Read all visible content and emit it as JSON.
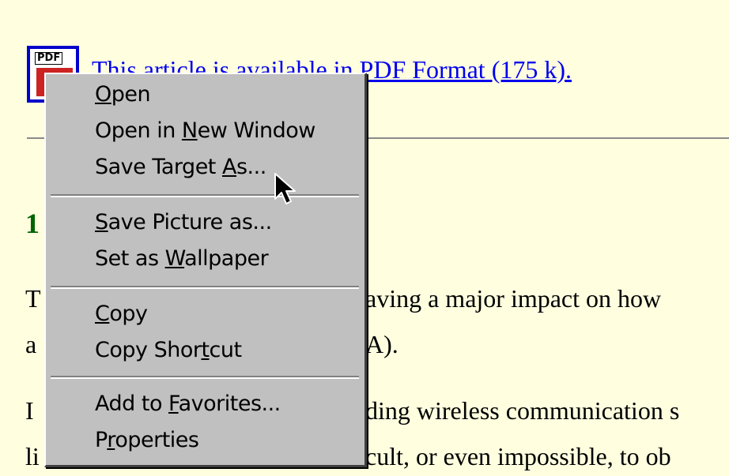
{
  "document": {
    "pdf_link_text": "This article is available in PDF Format (175 k).",
    "heading_fragment": "1",
    "para1_start": "T",
    "para1_visible_tail": "aving a major impact on how",
    "para2_start": "a",
    "para2_visible_tail": "A).",
    "para3_start": "I",
    "para3_visible_tail": "ding wireless communication s",
    "para4_start": "li",
    "para4_visible_tail": "cult, or even impossible, to ob"
  },
  "icons": {
    "pdf_icon_label": "PDF"
  },
  "context_menu": {
    "items": [
      {
        "prefix": "",
        "accel": "O",
        "suffix": "pen"
      },
      {
        "prefix": "Open in ",
        "accel": "N",
        "suffix": "ew Window"
      },
      {
        "prefix": "Save Target ",
        "accel": "A",
        "suffix": "s..."
      },
      {
        "prefix": "",
        "accel": "S",
        "suffix": "ave Picture as..."
      },
      {
        "prefix": "Set as ",
        "accel": "W",
        "suffix": "allpaper"
      },
      {
        "prefix": "",
        "accel": "C",
        "suffix": "opy"
      },
      {
        "prefix": "Copy Shor",
        "accel": "t",
        "suffix": "cut"
      },
      {
        "prefix": "Add to ",
        "accel": "F",
        "suffix": "avorites..."
      },
      {
        "prefix": "P",
        "accel": "r",
        "suffix": "operties"
      }
    ]
  },
  "colors": {
    "page_background": "#ffffe0",
    "link": "#0000ee",
    "heading": "#006400",
    "menu_face": "#c0c0c0"
  }
}
